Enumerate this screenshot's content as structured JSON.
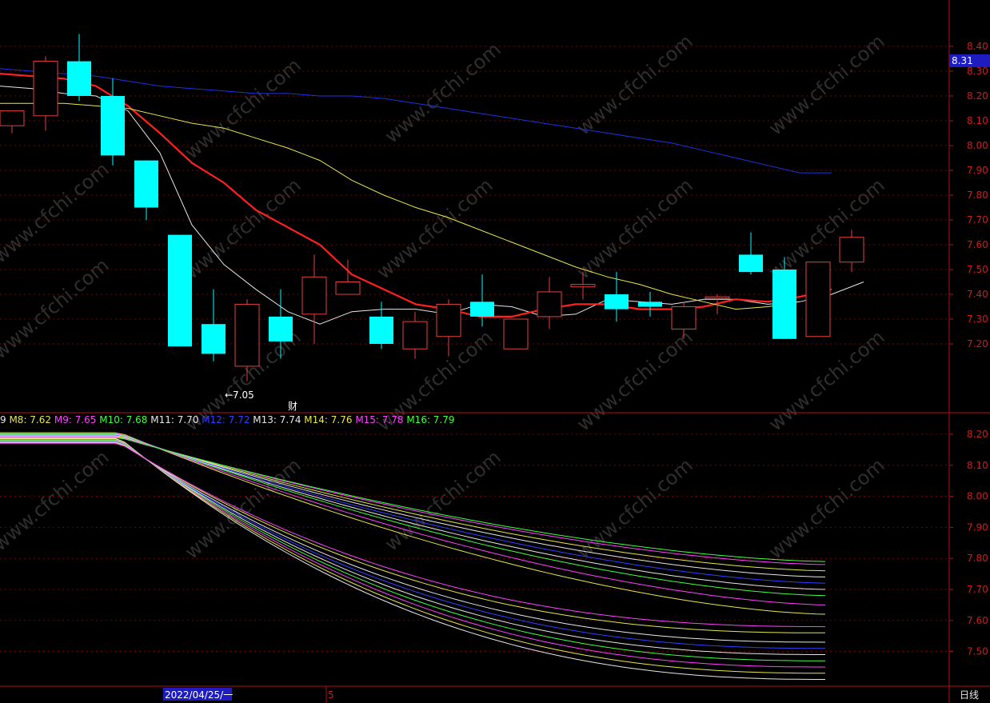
{
  "colors": {
    "background": "#000000",
    "frame": "#b01010",
    "grid": "#7a0000",
    "tick_text": "#c81e1e",
    "up_candle": "#e04040",
    "down_candle": "#00ffff",
    "ma_white": "#e6e6e6",
    "ma_red": "#ff2020",
    "ma_yellow": "#e6e64a",
    "ma_blue": "#2030e0"
  },
  "watermark_text": "www.cfchi.com",
  "price_tag": "8.31",
  "min_marker": "←7.05",
  "event_marker": "财",
  "date_label": "2022/04/25/一",
  "month_marker": "5",
  "period_label": "日线",
  "top_ticks": [
    "8.40",
    "8.30",
    "8.20",
    "8.10",
    "8.00",
    "7.90",
    "7.80",
    "7.70",
    "7.60",
    "7.50",
    "7.40",
    "7.30",
    "7.20"
  ],
  "bottom_ticks": [
    "8.20",
    "8.10",
    "8.00",
    "7.90",
    "7.80",
    "7.70",
    "7.60",
    "7.50"
  ],
  "legend": [
    {
      "text": "9",
      "color": "#e6e6e6"
    },
    {
      "text": "M8: 7.62",
      "color": "#e6e64a"
    },
    {
      "text": "M9: 7.65",
      "color": "#ff40ff"
    },
    {
      "text": "M10: 7.68",
      "color": "#40ff40"
    },
    {
      "text": "M11: 7.70",
      "color": "#e6e6e6"
    },
    {
      "text": "M12: 7.72",
      "color": "#3040ff"
    },
    {
      "text": "M13: 7.74",
      "color": "#e6e6e6"
    },
    {
      "text": "M14: 7.76",
      "color": "#e6e64a"
    },
    {
      "text": "M15: 7.78",
      "color": "#ff40ff"
    },
    {
      "text": "M16: 7.79",
      "color": "#40ff40"
    }
  ],
  "chart_data": [
    {
      "type": "candlestick",
      "title": "",
      "ylim": [
        7.05,
        8.45
      ],
      "candles": [
        {
          "o": 8.08,
          "h": 8.13,
          "l": 8.05,
          "c": 8.14
        },
        {
          "o": 8.12,
          "h": 8.36,
          "l": 8.06,
          "c": 8.34
        },
        {
          "o": 8.34,
          "h": 8.45,
          "l": 8.18,
          "c": 8.2
        },
        {
          "o": 8.2,
          "h": 8.27,
          "l": 7.92,
          "c": 7.96
        },
        {
          "o": 7.94,
          "h": 7.94,
          "l": 7.7,
          "c": 7.75
        },
        {
          "o": 7.64,
          "h": 7.64,
          "l": 7.19,
          "c": 7.19
        },
        {
          "o": 7.28,
          "h": 7.42,
          "l": 7.13,
          "c": 7.16
        },
        {
          "o": 7.11,
          "h": 7.38,
          "l": 7.05,
          "c": 7.36
        },
        {
          "o": 7.31,
          "h": 7.42,
          "l": 7.14,
          "c": 7.21
        },
        {
          "o": 7.32,
          "h": 7.56,
          "l": 7.2,
          "c": 7.47
        },
        {
          "o": 7.4,
          "h": 7.54,
          "l": 7.4,
          "c": 7.45
        },
        {
          "o": 7.31,
          "h": 7.37,
          "l": 7.18,
          "c": 7.2
        },
        {
          "o": 7.18,
          "h": 7.33,
          "l": 7.14,
          "c": 7.29
        },
        {
          "o": 7.23,
          "h": 7.38,
          "l": 7.15,
          "c": 7.36
        },
        {
          "o": 7.37,
          "h": 7.48,
          "l": 7.27,
          "c": 7.31
        },
        {
          "o": 7.18,
          "h": 7.3,
          "l": 7.18,
          "c": 7.3
        },
        {
          "o": 7.31,
          "h": 7.47,
          "l": 7.26,
          "c": 7.41
        },
        {
          "o": 7.43,
          "h": 7.49,
          "l": 7.38,
          "c": 7.44
        },
        {
          "o": 7.4,
          "h": 7.49,
          "l": 7.29,
          "c": 7.34
        },
        {
          "o": 7.37,
          "h": 7.41,
          "l": 7.31,
          "c": 7.35
        },
        {
          "o": 7.26,
          "h": 7.37,
          "l": 7.22,
          "c": 7.35
        },
        {
          "o": 7.39,
          "h": 7.4,
          "l": 7.32,
          "c": 7.39
        },
        {
          "o": 7.56,
          "h": 7.65,
          "l": 7.48,
          "c": 7.49
        },
        {
          "o": 7.5,
          "h": 7.55,
          "l": 7.22,
          "c": 7.22
        },
        {
          "o": 7.23,
          "h": 7.53,
          "l": 7.23,
          "c": 7.53
        },
        {
          "o": 7.53,
          "h": 7.66,
          "l": 7.49,
          "c": 7.63
        }
      ],
      "series": [
        {
          "color": "#e6e6e6",
          "values": [
            8.24,
            8.23,
            8.21,
            8.2,
            8.14,
            7.97,
            7.68,
            7.52,
            7.42,
            7.33,
            7.28,
            7.33,
            7.34,
            7.34,
            7.32,
            7.36,
            7.35,
            7.31,
            7.32,
            7.38,
            7.37,
            7.36,
            7.38,
            7.38,
            7.36,
            7.37,
            7.4,
            7.45
          ]
        },
        {
          "color": "#ff2020",
          "values": [
            8.29,
            8.28,
            8.27,
            8.24,
            8.16,
            8.05,
            7.93,
            7.85,
            7.74,
            7.67,
            7.6,
            7.48,
            7.42,
            7.36,
            7.34,
            7.31,
            7.31,
            7.34,
            7.36,
            7.36,
            7.34,
            7.34,
            7.35,
            7.38,
            7.37,
            7.39,
            7.42
          ]
        },
        {
          "color": "#e6e64a",
          "values": [
            8.17,
            8.17,
            8.17,
            8.16,
            8.15,
            8.12,
            8.09,
            8.07,
            8.03,
            7.99,
            7.94,
            7.86,
            7.8,
            7.75,
            7.71,
            7.66,
            7.61,
            7.56,
            7.51,
            7.47,
            7.44,
            7.4,
            7.37,
            7.34,
            7.35,
            7.37
          ]
        },
        {
          "color": "#2030e0",
          "values": [
            8.31,
            8.3,
            8.29,
            8.28,
            8.26,
            8.24,
            8.23,
            8.22,
            8.21,
            8.21,
            8.2,
            8.2,
            8.19,
            8.17,
            8.15,
            8.13,
            8.11,
            8.09,
            8.07,
            8.05,
            8.03,
            8.01,
            7.98,
            7.95,
            7.92,
            7.89,
            7.89
          ]
        }
      ]
    },
    {
      "type": "line",
      "title": "",
      "ylim": [
        7.42,
        8.22
      ],
      "series": [
        {
          "name": "M8",
          "color": "#e6e64a",
          "end": 7.62
        },
        {
          "name": "M9",
          "color": "#ff40ff",
          "end": 7.65
        },
        {
          "name": "M10",
          "color": "#40ff40",
          "end": 7.68
        },
        {
          "name": "M11",
          "color": "#e6e6e6",
          "end": 7.7
        },
        {
          "name": "M12",
          "color": "#3040ff",
          "end": 7.72
        },
        {
          "name": "M13",
          "color": "#e6e6e6",
          "end": 7.74
        },
        {
          "name": "M14",
          "color": "#e6e64a",
          "end": 7.76
        },
        {
          "name": "M15",
          "color": "#ff40ff",
          "end": 7.78
        },
        {
          "name": "M16",
          "color": "#40ff40",
          "end": 7.79
        }
      ],
      "extra_lower_series_ends": [
        7.41,
        7.43,
        7.45,
        7.47,
        7.49,
        7.51,
        7.53,
        7.56,
        7.58
      ]
    }
  ]
}
